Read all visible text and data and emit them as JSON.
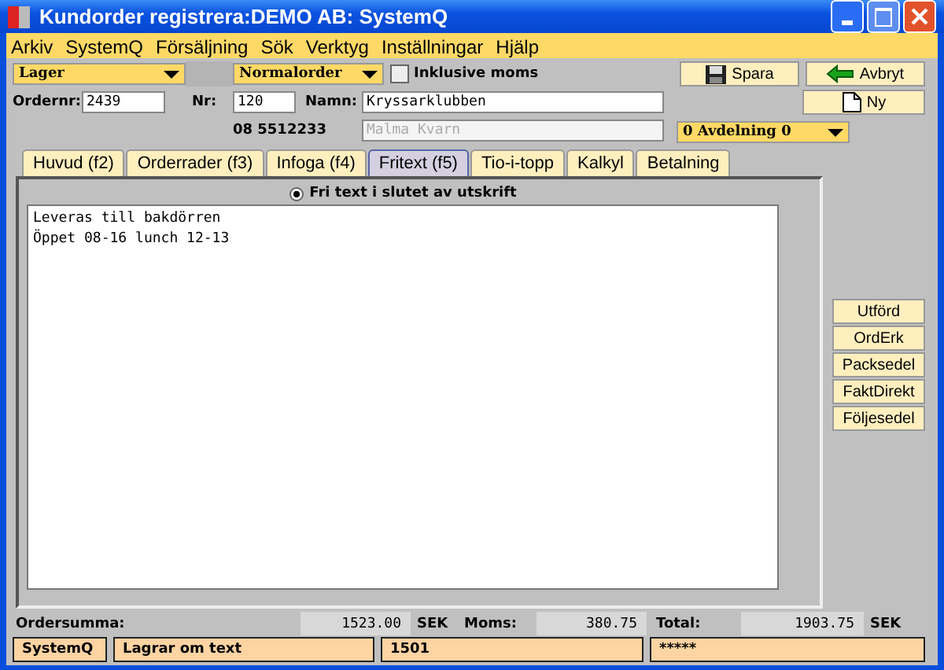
{
  "window": {
    "title": "Kundorder registrera:DEMO AB: SystemQ"
  },
  "menu": [
    "Arkiv",
    "SystemQ",
    "Försäljning",
    "Sök",
    "Verktyg",
    "Inställningar",
    "Hjälp"
  ],
  "header": {
    "warehouse": "Lager",
    "order_type": "Normalorder",
    "vat_included": {
      "label": "Inklusive moms",
      "checked": false
    },
    "order_no": {
      "label": "Ordernr:",
      "value": "2439"
    },
    "nr": {
      "label": "Nr:",
      "value": "120"
    },
    "name": {
      "label": "Namn:",
      "value": "Kryssarklubben"
    },
    "phone": "08 5512233",
    "name2": {
      "value": "Malma Kvarn",
      "disabled": true
    },
    "department": "0   Avdelning 0"
  },
  "buttons": [
    {
      "label": "Spara",
      "kind": "save"
    },
    {
      "label": "Avbryt",
      "kind": "cancel"
    },
    {
      "label": "Ny",
      "kind": "new"
    }
  ],
  "tabs": [
    {
      "label": "Huvud (f2)",
      "selected": false
    },
    {
      "label": "Orderrader (f3)",
      "selected": false
    },
    {
      "label": "Infoga (f4)",
      "selected": false
    },
    {
      "label": "Fritext (f5)",
      "selected": true
    },
    {
      "label": "Tio-i-topp",
      "selected": false
    },
    {
      "label": "Kalkyl",
      "selected": false
    },
    {
      "label": "Betalning",
      "selected": false
    }
  ],
  "radio": {
    "label": "Fri text i slutet av utskrift",
    "selected": true
  },
  "text_lines": [
    "Leveras till bakdörren",
    "Öppet 08-16 lunch 12-13"
  ],
  "side_buttons": [
    "Utförd",
    "OrdErk",
    "Packsedel",
    "FaktDirekt",
    "Följesedel"
  ],
  "totals": {
    "sum_label": "Ordersumma:",
    "sum": "1523.00",
    "currency1": "SEK",
    "vat_label": "Moms:",
    "vat": "380.75",
    "total_label": "Total:",
    "total": "1903.75",
    "currency2": "SEK"
  },
  "status_bar": [
    "SystemQ",
    "Lagrar om text",
    "1501",
    "*****"
  ]
}
